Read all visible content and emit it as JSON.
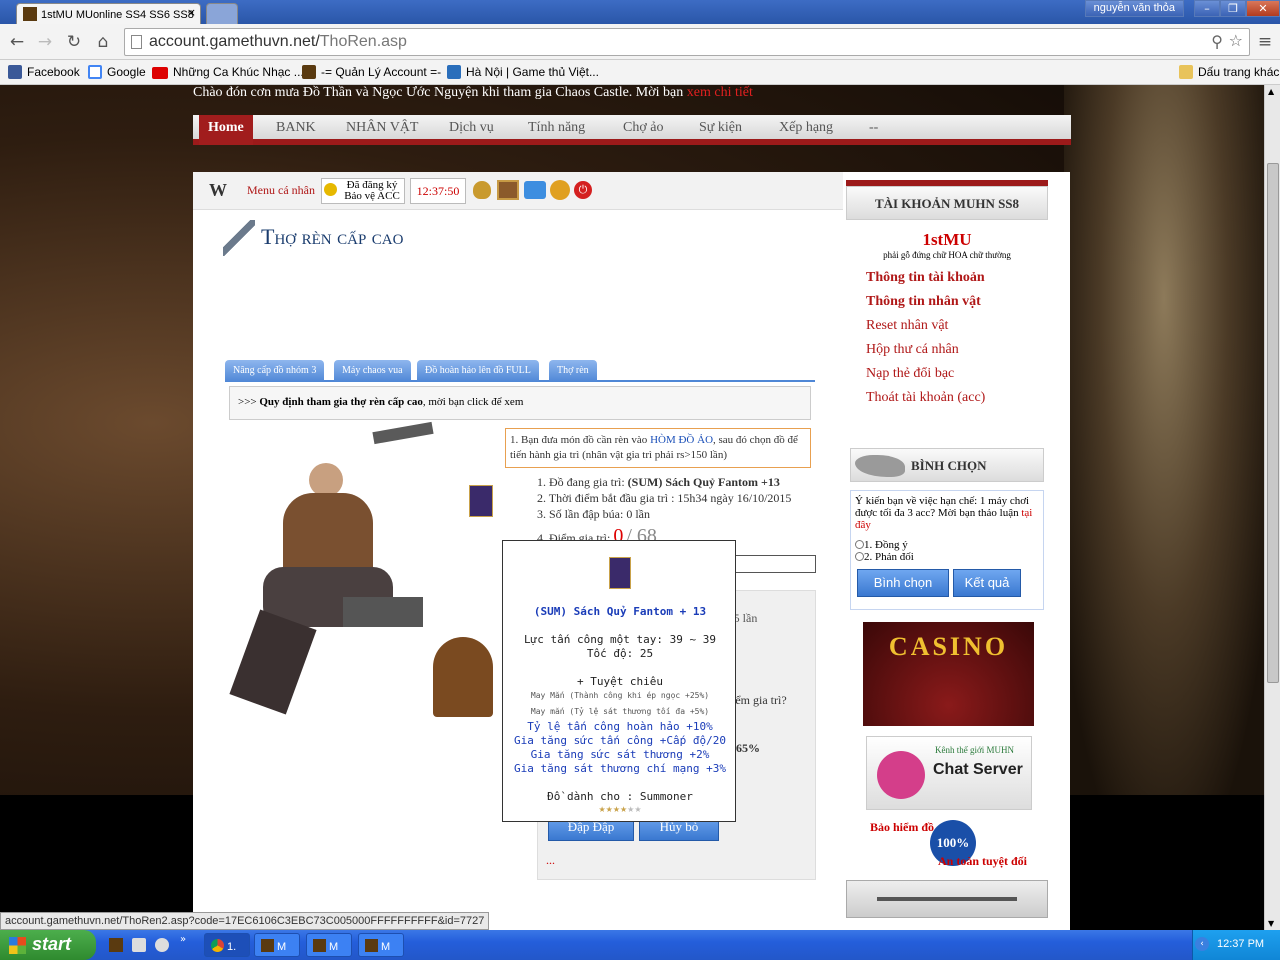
{
  "browser": {
    "tab_title": "1stMU MUonline SS4 SS6 SS8",
    "user_name": "nguyễn văn thỏa",
    "url_host": "account.gamethuvn.net/",
    "url_path": "ThoRen.asp",
    "bookmarks": [
      "Facebook",
      "Google",
      "Những Ca Khúc Nhạc ...",
      "-= Quản Lý Account =-",
      "Hà Nội | Game thủ Việt...",
      "Dấu trang khác"
    ]
  },
  "site": {
    "welcome_text": "Chào đón cơn mưa Đồ Thần và Ngọc Ước Nguyện khi tham gia Chaos Castle. Mời bạn",
    "welcome_link": "xem chi tiết",
    "nav": [
      "Home",
      "BANK",
      "NHÂN VẬT",
      "Dịch vụ",
      "Tính năng",
      "Chợ ảo",
      "Sự kiện",
      "Xếp hạng",
      "--"
    ],
    "topbar": {
      "menu_label": "Menu cá nhân",
      "register_line1": "Đã đăng ký",
      "register_line2": "Bảo vệ ACC",
      "clock": "12:37:50"
    },
    "page_title": "Thợ rèn cấp cao",
    "tabs": [
      "Nâng cấp đồ nhóm 3",
      "Máy chaos vua",
      "Đồ hoàn hảo lên đồ FULL",
      "Thợ rèn"
    ],
    "rules_prefix": ">>>",
    "rules_bold": "Quy định tham gia thợ rèn cấp cao",
    "rules_rest": ", mời bạn click để xem",
    "instruction_a": "1. Bạn đưa món đồ cần rèn vào",
    "instruction_link": "HÒM ĐỒ ẢO",
    "instruction_b": ", sau đó chọn đồ để tiến hành gia trì (nhân vật gia trì phải rs>150 lần)",
    "info": {
      "line1_prefix": "1. Đồ đang gia trì:",
      "line1_item": "(SUM) Sách Quỷ Fantom +13",
      "line2": "2. Thời điểm bắt đầu gia trì : 15h34 ngày 16/10/2015",
      "line3": "3. Số lần đập búa: 0 lần",
      "line4_prefix": "4. Điểm gia trì:",
      "score_current": "0",
      "score_total": "/ 68"
    },
    "hidden_fragments": {
      "reset": "reset 705 lần",
      "question": "iểm gia trì?",
      "pct": "65%"
    },
    "buttons": {
      "hit": "Đập Đập",
      "cancel": "Hủy bỏ"
    },
    "dots": "..."
  },
  "tooltip": {
    "item_name": "(SUM) Sách Quỷ Fantom + 13",
    "attack": "Lực tấn công một tay: 39 ~ 39",
    "speed": "Tốc độ: 25",
    "skill": "+ Tuyệt chiêu",
    "luck1": "May Mắn (Thành công khi ép ngọc +25%)",
    "luck2": "May mắn (Tỷ lệ sát thương tối đa +5%)",
    "excellent": [
      "Tỷ lệ tấn công hoàn hảo +10%",
      "Gia tăng sức tấn công +Cấp độ/20",
      "Gia tăng sức sát thương +2%",
      "Gia tăng sát thương chí mạng +3%"
    ],
    "class": "Đồ dành cho : Summoner"
  },
  "sidebar": {
    "account_header": "TÀI KHOẢN MUHN SS8",
    "logo": "1stMU",
    "logo_sub": "phải gỗ đứng chữ HOA chữ thường",
    "links": [
      "Thông tin tài khoản",
      "Thông tin nhân vật",
      "Reset nhân vật",
      "Hộp thư cá nhân",
      "Nạp thẻ đổi bạc",
      "Thoát tài khoản (acc)"
    ],
    "vote_header": "BÌNH CHỌN",
    "vote_question": "Ý kiến bạn về việc hạn chế: 1 máy chơi được tối đa 3 acc? Mời bạn thảo luận",
    "vote_link": "tại đây",
    "options": [
      "1. Đồng ý",
      "2. Phản đối"
    ],
    "vote_btn": "Bình chọn",
    "result_btn": "Kết quả",
    "casino": "CASINO",
    "chat_small": "Kênh thế giới MUHN",
    "chat_big": "Chat Server",
    "insure_top": "Bảo hiểm đồ",
    "insure_bottom": "An toàn tuyệt đối",
    "badge": "100%"
  },
  "status_bar": "account.gamethuvn.net/ThoRen2.asp?code=17EC6106C3EBC73C005000FFFFFFFFFF&id=7727",
  "taskbar": {
    "start": "start",
    "tasks": [
      "1.",
      "M",
      "M",
      "M"
    ],
    "time": "12:37 PM"
  }
}
